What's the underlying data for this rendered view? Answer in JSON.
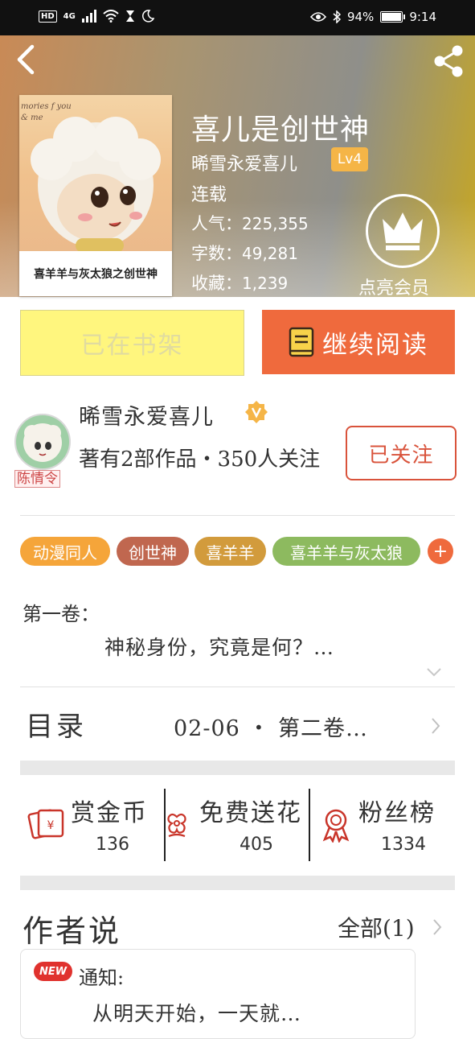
{
  "status_bar": {
    "hd": "HD",
    "network": "4G",
    "battery": "94%",
    "time": "9:14",
    "battery_level": 0.94
  },
  "header": {
    "title": "喜儿是创世神",
    "author": "晞雪永爱喜儿",
    "level": "Lv4",
    "status": "连载",
    "stats": [
      {
        "label": "人气：",
        "value": "225,355"
      },
      {
        "label": "字数：",
        "value": "49,281"
      },
      {
        "label": "收藏：",
        "value": "1,239"
      }
    ],
    "member_label": "点亮会员",
    "cover_caption": "喜羊羊与灰太狼之创世神",
    "cover_text": "mories f you & me"
  },
  "actions": {
    "shelf_label": "已在书架",
    "read_label": "继续阅读"
  },
  "author": {
    "name": "晞雪永爱喜儿",
    "works_info": "著有2部作品・350人关注",
    "follow_label": "已关注",
    "avatar_tag": "陈情令"
  },
  "tags": [
    {
      "label": "动漫同人",
      "color": "#f5a53a"
    },
    {
      "label": "创世神",
      "color": "#c0674f"
    },
    {
      "label": "喜羊羊",
      "color": "#d29b3c"
    },
    {
      "label": "喜羊羊与灰太狼",
      "color": "#8dba5f"
    },
    {
      "label": "+",
      "color": "#ef6a3d"
    }
  ],
  "summary": {
    "volume": "第一卷：",
    "text": "神秘身份，究竟是何？…"
  },
  "toc": {
    "label": "目录",
    "latest": "02-06 ・ 第二卷…"
  },
  "support": [
    {
      "label": "赏金币",
      "count": "136",
      "icon": "red-envelope-icon"
    },
    {
      "label": "免费送花",
      "count": "405",
      "icon": "flower-icon"
    },
    {
      "label": "粉丝榜",
      "count": "1334",
      "icon": "medal-icon"
    }
  ],
  "author_says": {
    "title": "作者说",
    "all_label": "全部(1)",
    "badge": "NEW",
    "notice_title": "通知:",
    "notice_text": "从明天开始，一天就…"
  },
  "colors": {
    "accent": "#ef6a3d",
    "shelf_button": "#fff67e",
    "follow_border": "#d9533b",
    "level_badge": "#f5b547"
  }
}
